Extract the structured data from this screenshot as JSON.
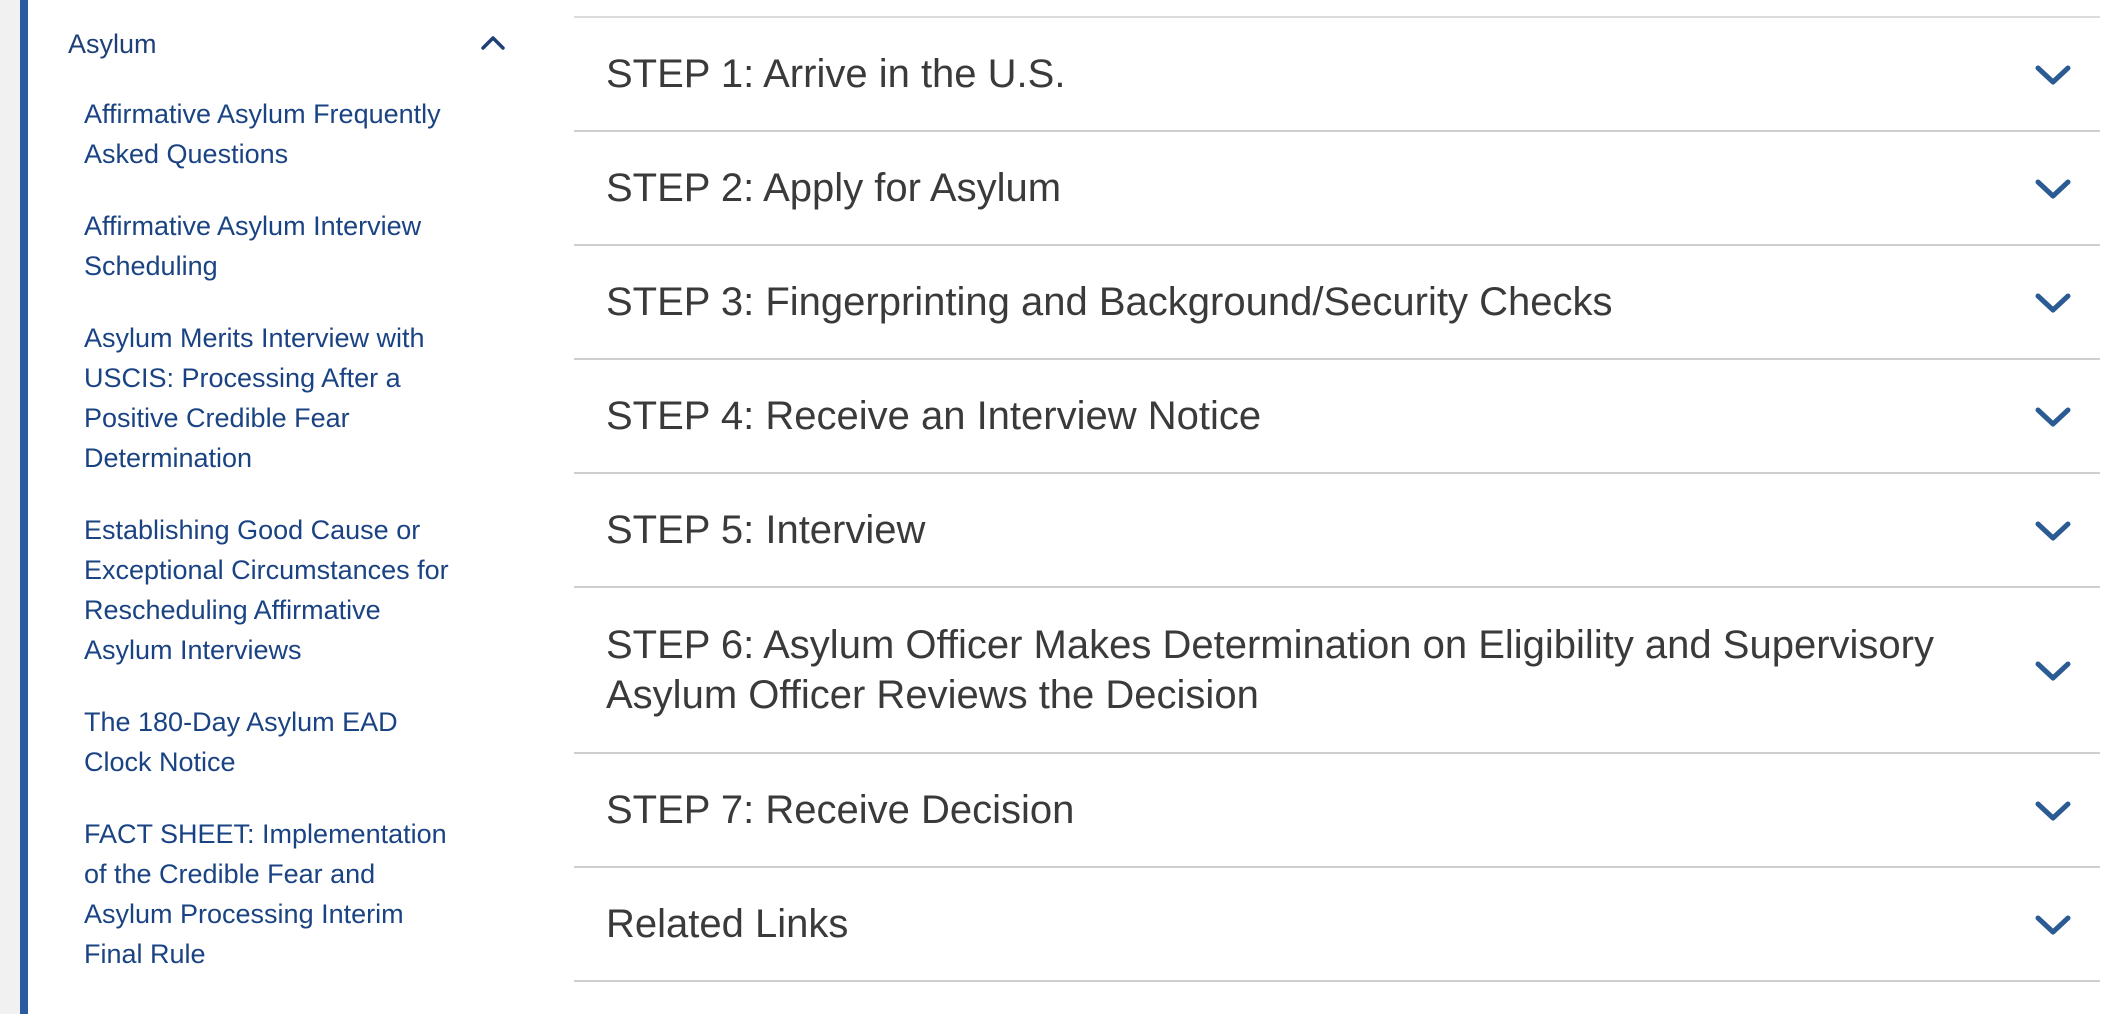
{
  "sidebar": {
    "section_title": "Asylum",
    "items": [
      "Affirmative Asylum Frequently Asked Questions",
      "Affirmative Asylum Interview Scheduling",
      "Asylum Merits Interview with USCIS: Processing After a Positive Credible Fear Determination",
      "Establishing Good Cause or Exceptional Circumstances for Rescheduling Affirmative Asylum Interviews",
      "The 180-Day Asylum EAD Clock Notice",
      "FACT SHEET: Implementation of the Credible Fear and Asylum Processing Interim Final Rule"
    ]
  },
  "accordion": {
    "steps": [
      "STEP 1: Arrive in the U.S.",
      "STEP 2: Apply for Asylum",
      "STEP 3: Fingerprinting and Background/Security Checks",
      "STEP 4: Receive an Interview Notice",
      "STEP 5: Interview",
      "STEP 6: Asylum Officer Makes Determination on Eligibility and Supervisory Asylum Officer Reviews the Decision",
      "STEP 7: Receive Decision",
      "Related Links"
    ]
  },
  "icons": {
    "section_toggle": "chevron-up-icon",
    "accordion_toggle": "chevron-down-icon"
  },
  "colors": {
    "nav_link": "#1a4384",
    "accent_bar": "#2c5aa0",
    "chevron": "#2a5c93",
    "step_text": "#3a3a3a"
  }
}
